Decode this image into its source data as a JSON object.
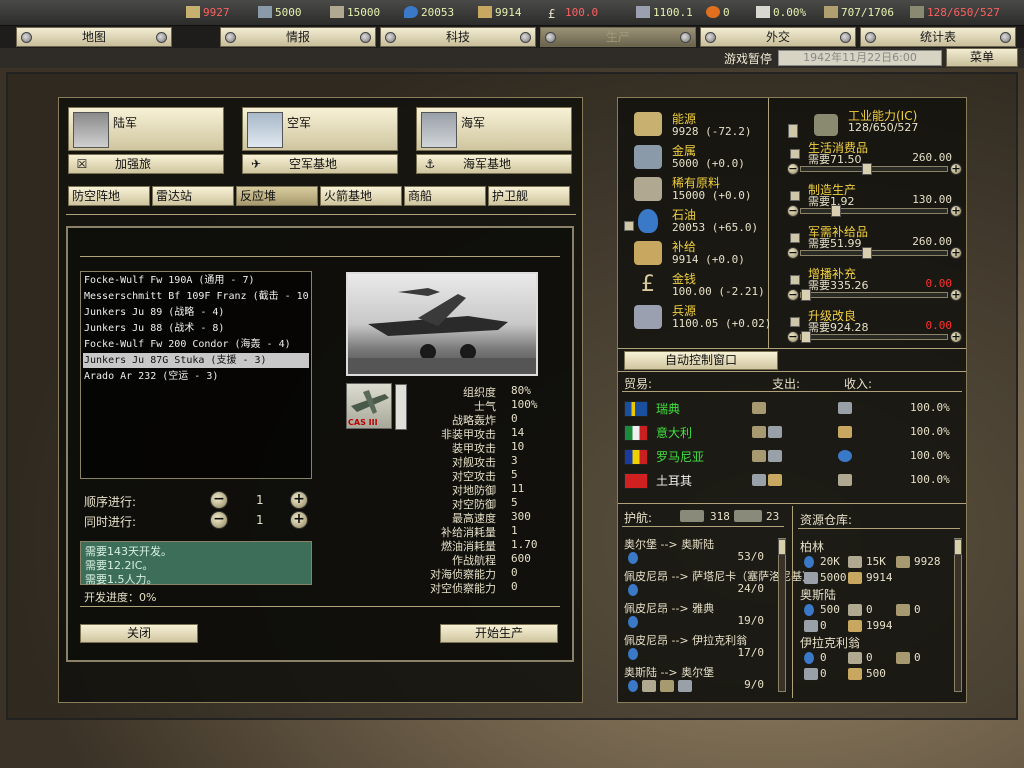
{
  "topbar": {
    "resources": [
      {
        "name": "energy-icon",
        "value": "9927",
        "color": "#ff6060"
      },
      {
        "name": "metal-icon",
        "value": "5000",
        "color": "#e6f0b0"
      },
      {
        "name": "rare-materials-icon",
        "value": "15000",
        "color": "#e6f0b0"
      },
      {
        "name": "oil-icon",
        "value": "20053",
        "color": "#e6f0b0"
      },
      {
        "name": "supplies-icon",
        "value": "9914",
        "color": "#e6f0b0"
      },
      {
        "name": "money-icon",
        "value": "100.0",
        "color": "#ff6060"
      }
    ],
    "stats": [
      {
        "name": "manpower-icon",
        "value": "1100.1"
      },
      {
        "name": "nuke-icon",
        "value": "0"
      },
      {
        "name": "dissent-icon",
        "value": "0.00%"
      },
      {
        "name": "transport-icon",
        "value": "707/1706"
      },
      {
        "name": "ic-icon",
        "value": "128/650/527"
      }
    ]
  },
  "nav": {
    "tabs": [
      {
        "label": "地图",
        "dim": false
      },
      {
        "label": "情报",
        "dim": false
      },
      {
        "label": "科技",
        "dim": false
      },
      {
        "label": "生产",
        "dim": true
      },
      {
        "label": "外交",
        "dim": false
      },
      {
        "label": "统计表",
        "dim": false
      }
    ],
    "pause_label": "游戏暂停",
    "date": "1942年11月22日6:00",
    "menu_label": "菜单"
  },
  "production": {
    "branches": [
      {
        "label": "陆军",
        "sub_label": "加强旅",
        "sub_icon": "☒"
      },
      {
        "label": "空军",
        "sub_label": "空军基地",
        "sub_icon": "✈"
      },
      {
        "label": "海军",
        "sub_label": "海军基地",
        "sub_icon": "⚓"
      }
    ],
    "tabs": [
      "防空阵地",
      "雷达站",
      "反应堆",
      "火箭基地",
      "商船",
      "护卫舰"
    ],
    "selected_tab": 2,
    "units": [
      "Focke-Wulf Fw 190A (通用 - 7)",
      "Messerschmitt Bf 109F Franz (截击 - 10)",
      "Junkers Ju 89 (战略 - 4)",
      "Junkers Ju 88 (战术 - 8)",
      "Focke-Wulf Fw 200 Condor (海轰 - 4)",
      "Junkers Ju 87G Stuka (支援 - 3)",
      "Arado Ar 232 (空运 - 3)"
    ],
    "selected_unit": 5,
    "unit_badge": "CAS III",
    "stats": [
      {
        "label": "组织度",
        "value": "80%"
      },
      {
        "label": "士气",
        "value": "100%"
      },
      {
        "label": "战略轰炸",
        "value": "0"
      },
      {
        "label": "非装甲攻击",
        "value": "14"
      },
      {
        "label": "装甲攻击",
        "value": "10"
      },
      {
        "label": "对舰攻击",
        "value": "3"
      },
      {
        "label": "对空攻击",
        "value": "5"
      },
      {
        "label": "对地防御",
        "value": "11"
      },
      {
        "label": "对空防御",
        "value": "5"
      },
      {
        "label": "最高速度",
        "value": "300"
      },
      {
        "label": "补给消耗量",
        "value": "1"
      },
      {
        "label": "燃油消耗量",
        "value": "1.70"
      },
      {
        "label": "作战航程",
        "value": "600"
      },
      {
        "label": "对海侦察能力",
        "value": "0"
      },
      {
        "label": "对空侦察能力",
        "value": "0"
      }
    ],
    "serial_label": "顺序进行:",
    "serial_value": "1",
    "parallel_label": "同时进行:",
    "parallel_value": "1",
    "requirements": [
      "需要143天开发。",
      "需要12.2IC。",
      "需要1.5人力。"
    ],
    "progress": "开发进度：0%",
    "close_label": "关闭",
    "start_label": "开始生产"
  },
  "resources": [
    {
      "name": "能源",
      "value": "9928 (-72.2)",
      "icon": "energy-icon",
      "color": "#c8b070"
    },
    {
      "name": "金属",
      "value": "5000 (+0.0)",
      "icon": "metal-icon",
      "color": "#8a9aa8"
    },
    {
      "name": "稀有原料",
      "value": "15000 (+0.0)",
      "icon": "rare-materials-icon",
      "color": "#b0a890"
    },
    {
      "name": "石油",
      "value": "20053 (+65.0)",
      "icon": "oil-icon",
      "color": "#3a78c8"
    },
    {
      "name": "补给",
      "value": "9914 (+0.0)",
      "icon": "supplies-icon",
      "color": "#c8a860"
    },
    {
      "name": "金钱",
      "value": "100.00 (-2.21)",
      "icon": "money-icon",
      "color": "#d8c8a0"
    },
    {
      "name": "兵源",
      "value": "1100.05 (+0.02)",
      "icon": "manpower-icon",
      "color": "#9aa0b0"
    }
  ],
  "industry": {
    "title": "工业能力(IC)",
    "total": "128/650/527",
    "rows": [
      {
        "name": "生活消费品",
        "need": "需要71.50",
        "value": "260.00",
        "red": false,
        "level": 0.45
      },
      {
        "name": "制造生产",
        "need": "需要1.92",
        "value": "130.00",
        "red": false,
        "level": 0.22
      },
      {
        "name": "军需补给品",
        "need": "需要51.99",
        "value": "260.00",
        "red": false,
        "level": 0.45
      },
      {
        "name": "增播补充",
        "need": "需要335.26",
        "value": "0.00",
        "red": true,
        "level": 0.0
      },
      {
        "name": "升级改良",
        "need": "需要924.28",
        "value": "0.00",
        "red": true,
        "level": 0.0
      }
    ],
    "auto_label": "自动控制窗口"
  },
  "trade": {
    "header": "贸易:",
    "export_header": "支出:",
    "import_header": "收入:",
    "rows": [
      {
        "country": "瑞典",
        "flag": "sweden",
        "pct": "100.0%",
        "green": true
      },
      {
        "country": "意大利",
        "flag": "italy",
        "pct": "100.0%",
        "green": true
      },
      {
        "country": "罗马尼亚",
        "flag": "romania",
        "pct": "100.0%",
        "green": true
      },
      {
        "country": "土耳其",
        "flag": "turkey",
        "pct": "100.0%",
        "green": false
      }
    ]
  },
  "convoy": {
    "header": "护航:",
    "ships": "318",
    "escorts": "23",
    "routes": [
      {
        "route": "奥尔堡 --> 奥斯陆",
        "num": "53/0"
      },
      {
        "route": "佩皮尼昂 --> 萨塔尼卡（塞萨洛尼基）",
        "num": "24/0"
      },
      {
        "route": "佩皮尼昂 --> 雅典",
        "num": "19/0"
      },
      {
        "route": "佩皮尼昂 --> 伊拉克利翁",
        "num": "17/0"
      },
      {
        "route": "奥斯陆 --> 奥尔堡",
        "num": "9/0"
      }
    ]
  },
  "depot": {
    "header": "资源仓库:",
    "cities": [
      {
        "name": "柏林",
        "a": "20K",
        "b": "15K",
        "c": "9928",
        "d": "5000",
        "e": "9914"
      },
      {
        "name": "奥斯陆",
        "a": "500",
        "b": "0",
        "c": "0",
        "d": "0",
        "e": "1994"
      },
      {
        "name": "伊拉克利翁",
        "a": "0",
        "b": "0",
        "c": "0",
        "d": "0",
        "e": "500"
      }
    ]
  }
}
